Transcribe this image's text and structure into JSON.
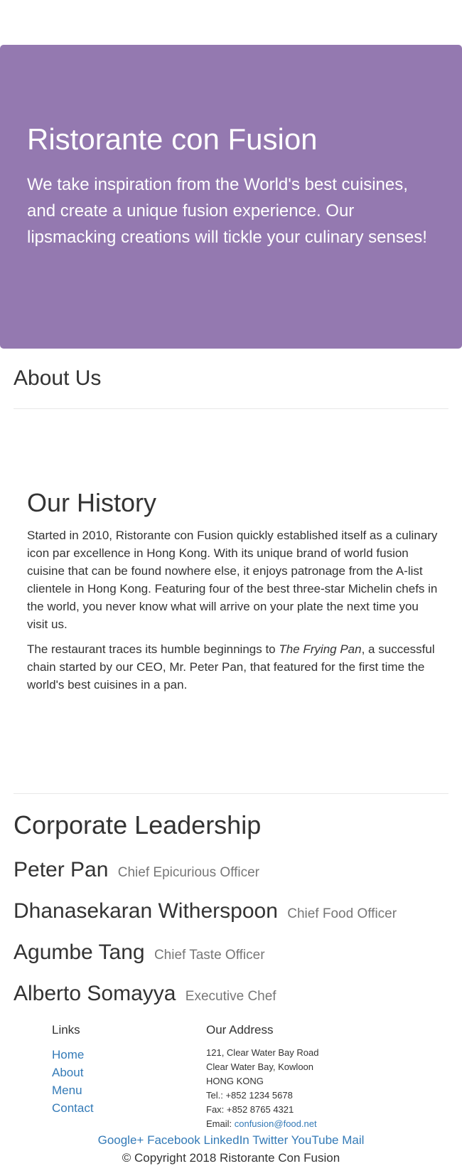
{
  "jumbotron": {
    "title": "Ristorante con Fusion",
    "tagline": "We take inspiration from the World's best cuisines, and create a unique fusion experience. Our lipsmacking creations will tickle your culinary senses!"
  },
  "about": {
    "heading": "About Us"
  },
  "history": {
    "heading": "Our History",
    "paragraph1": "Started in 2010, Ristorante con Fusion quickly established itself as a culinary icon par excellence in Hong Kong. With its unique brand of world fusion cuisine that can be found nowhere else, it enjoys patronage from the A-list clientele in Hong Kong. Featuring four of the best three-star Michelin chefs in the world, you never know what will arrive on your plate the next time you visit us.",
    "paragraph2_before": "The restaurant traces its humble beginnings to ",
    "paragraph2_em": "The Frying Pan",
    "paragraph2_after": ", a successful chain started by our CEO, Mr. Peter Pan, that featured for the first time the world's best cuisines in a pan."
  },
  "leadership": {
    "heading": "Corporate Leadership",
    "leaders": [
      {
        "name": "Peter Pan",
        "title": "Chief Epicurious Officer"
      },
      {
        "name": "Dhanasekaran Witherspoon",
        "title": "Chief Food Officer"
      },
      {
        "name": "Agumbe Tang",
        "title": "Chief Taste Officer"
      },
      {
        "name": "Alberto Somayya",
        "title": "Executive Chef"
      }
    ]
  },
  "footer": {
    "links_heading": "Links",
    "links": [
      "Home",
      "About",
      "Menu",
      "Contact"
    ],
    "address_heading": "Our Address",
    "address_lines": [
      "121, Clear Water Bay Road",
      "Clear Water Bay, Kowloon",
      "HONG KONG",
      "Tel.: +852 1234 5678",
      "Fax: +852 8765 4321"
    ],
    "email_label": "Email: ",
    "email": "confusion@food.net",
    "social": [
      "Google+",
      "Facebook",
      "LinkedIn",
      "Twitter",
      "YouTube",
      "Mail"
    ],
    "copyright": "© Copyright 2018 Ristorante Con Fusion"
  },
  "colors": {
    "jumbotron_bg": "#9479b0",
    "link": "#337ab7"
  }
}
